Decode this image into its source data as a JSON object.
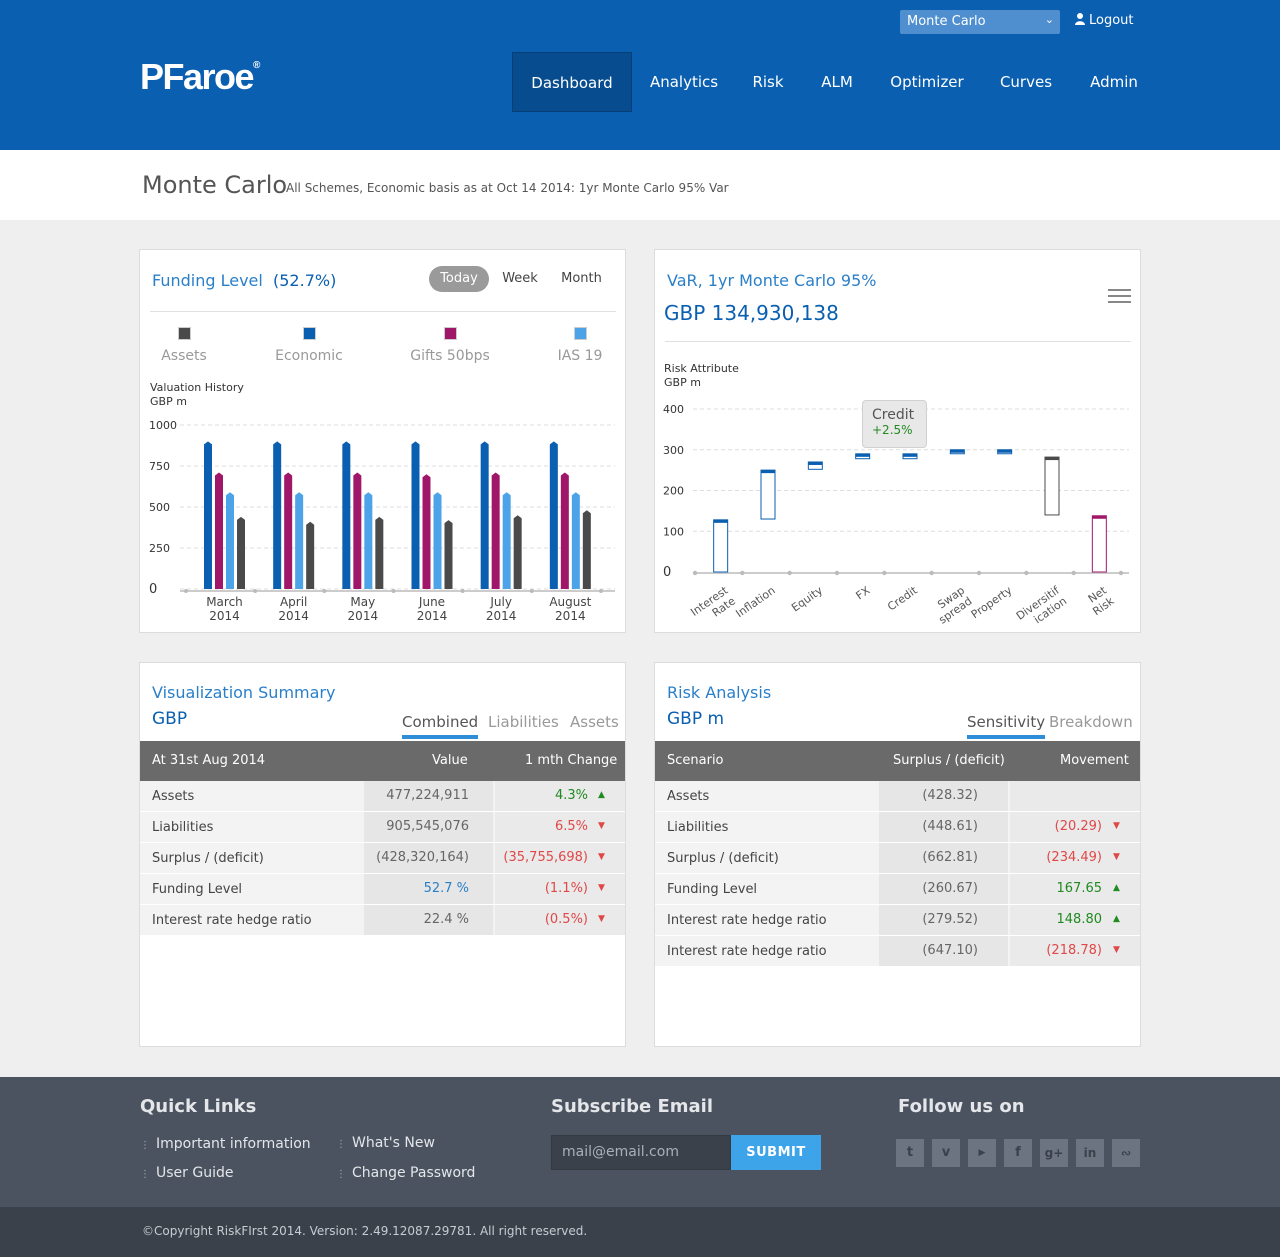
{
  "header": {
    "logo": "PFaroe",
    "logo_mark": "®",
    "scheme_select": "Monte Carlo",
    "logout": "Logout",
    "nav": [
      "Dashboard",
      "Analytics",
      "Risk",
      "ALM",
      "Optimizer",
      "Curves",
      "Admin"
    ],
    "active_nav": "Dashboard"
  },
  "title": {
    "main": "Monte Carlo",
    "sub": "All Schemes, Economic basis as at Oct 14 2014: 1yr Monte Carlo 95%  Var"
  },
  "funding": {
    "title": "Funding Level",
    "pct": "(52.7%)",
    "ranges": [
      "Today",
      "Week",
      "Month"
    ],
    "active_range": "Today",
    "legend": [
      {
        "label": "Assets",
        "color": "#4a4a4a"
      },
      {
        "label": "Economic",
        "color": "#0a5fb0"
      },
      {
        "label": "Gifts 50bps",
        "color": "#a0176a"
      },
      {
        "label": "IAS 19",
        "color": "#4da3e8"
      }
    ],
    "axis_caption_1": "Valuation History",
    "axis_caption_2": "GBP m"
  },
  "var": {
    "title": "VaR, 1yr Monte Carlo 95%",
    "amount": "GBP 134,930,138",
    "axis_caption_1": "Risk Attribute",
    "axis_caption_2": "GBP m",
    "tooltip_label": "Credit",
    "tooltip_value": "+2.5%",
    "menu_icon": "hamburger-icon"
  },
  "chart_data": [
    {
      "type": "bar",
      "ylim": [
        0,
        1000
      ],
      "yticks": [
        "1000",
        "750",
        "500",
        "250",
        "0"
      ],
      "categories": [
        "March\n2014",
        "April\n2014",
        "May\n2014",
        "June\n2014",
        "July\n2014",
        "August\n2014"
      ],
      "category_labels": [
        [
          "March",
          "2014"
        ],
        [
          "April",
          "2014"
        ],
        [
          "May",
          "2014"
        ],
        [
          "June",
          "2014"
        ],
        [
          "July",
          "2014"
        ],
        [
          "August",
          "2014"
        ]
      ],
      "series": [
        {
          "name": "Economic",
          "color": "#0a5fb0",
          "values": [
            900,
            900,
            900,
            900,
            900,
            900
          ]
        },
        {
          "name": "Gifts 50bps",
          "color": "#a0176a",
          "values": [
            710,
            710,
            710,
            700,
            710,
            710
          ]
        },
        {
          "name": "IAS 19",
          "color": "#4da3e8",
          "values": [
            590,
            590,
            590,
            590,
            590,
            590
          ]
        },
        {
          "name": "Assets",
          "color": "#4a4a4a",
          "values": [
            440,
            410,
            440,
            420,
            450,
            480
          ]
        }
      ]
    },
    {
      "type": "waterfall",
      "ylim": [
        0,
        400
      ],
      "yticks": [
        "400",
        "300",
        "200",
        "100",
        "0"
      ],
      "categories": [
        "Interest Rate",
        "Inflation",
        "Equity",
        "FX",
        "Credit",
        "Swap spread",
        "Property",
        "Diversification",
        "Net Risk"
      ],
      "category_labels": [
        [
          "Interest",
          "Rate"
        ],
        [
          "Inflation"
        ],
        [
          "Equity"
        ],
        [
          "FX"
        ],
        [
          "Credit"
        ],
        [
          "Swap",
          "spread"
        ],
        [
          "Property"
        ],
        [
          "Diversitif",
          "ication"
        ],
        [
          "Net",
          "Risk"
        ]
      ],
      "bars": [
        {
          "low": 0,
          "high": 128,
          "color": "#0a5fb0"
        },
        {
          "low": 130,
          "high": 250,
          "color": "#0a5fb0"
        },
        {
          "low": 252,
          "high": 270,
          "color": "#0a5fb0"
        },
        {
          "low": 278,
          "high": 290,
          "color": "#0a5fb0"
        },
        {
          "low": 278,
          "high": 290,
          "color": "#0a5fb0"
        },
        {
          "low": 292,
          "high": 300,
          "color": "#0a5fb0"
        },
        {
          "low": 292,
          "high": 300,
          "color": "#0a5fb0"
        },
        {
          "low": 140,
          "high": 282,
          "color": "#4a4a4a"
        },
        {
          "low": 0,
          "high": 138,
          "color": "#a0176a"
        }
      ]
    }
  ],
  "viz_summary": {
    "title": "Visualization Summary",
    "currency": "GBP",
    "tabs": [
      "Combined",
      "Liabilities",
      "Assets"
    ],
    "active_tab": "Combined",
    "headers": [
      "At 31st Aug 2014",
      "Value",
      "1 mth Change"
    ],
    "rows": [
      {
        "label": "Assets",
        "value": "477,224,911",
        "change": "4.3%",
        "dir": "up"
      },
      {
        "label": "Liabilities",
        "value": "905,545,076",
        "change": "6.5%",
        "dir": "down"
      },
      {
        "label": "Surplus / (deficit)",
        "value": "(428,320,164)",
        "change": "(35,755,698)",
        "dir": "down"
      },
      {
        "label": "Funding Level",
        "value": "52.7 %",
        "change": "(1.1%)",
        "dir": "down"
      },
      {
        "label": "Interest rate hedge ratio",
        "value": "22.4 %",
        "change": "(0.5%)",
        "dir": "down"
      }
    ]
  },
  "risk_analysis": {
    "title": "Risk Analysis",
    "currency": "GBP m",
    "tabs": [
      "Sensitivity",
      "Breakdown"
    ],
    "active_tab": "Sensitivity",
    "headers": [
      "Scenario",
      "Surplus / (deficit)",
      "Movement"
    ],
    "rows": [
      {
        "label": "Assets",
        "value": "(428.32)",
        "change": "",
        "dir": ""
      },
      {
        "label": "Liabilities",
        "value": "(448.61)",
        "change": "(20.29)",
        "dir": "down"
      },
      {
        "label": "Surplus / (deficit)",
        "value": "(662.81)",
        "change": "(234.49)",
        "dir": "down"
      },
      {
        "label": "Funding Level",
        "value": "(260.67)",
        "change": "167.65",
        "dir": "up"
      },
      {
        "label": "Interest rate hedge ratio",
        "value": "(279.52)",
        "change": "148.80",
        "dir": "up"
      },
      {
        "label": "Interest rate hedge ratio",
        "value": "(647.10)",
        "change": "(218.78)",
        "dir": "down"
      }
    ]
  },
  "footer": {
    "quick_links_title": "Quick Links",
    "links": [
      "Important information",
      "What's New",
      "User Guide",
      "Change Password"
    ],
    "subscribe_title": "Subscribe Email",
    "email_placeholder": "mail@email.com",
    "submit": "SUBMIT",
    "follow_title": "Follow us on",
    "social": [
      "twitter-icon",
      "vimeo-icon",
      "youtube-icon",
      "facebook-icon",
      "google-plus-icon",
      "linkedin-icon",
      "rss-icon"
    ],
    "copyright": "©Copyright RiskFIrst 2014. Version: 2.49.12087.29781. All right reserved."
  },
  "colors": {
    "brand": "#0a5fb0",
    "accent": "#2e8fd8",
    "up": "#2a9a2a",
    "down": "#e04848"
  }
}
